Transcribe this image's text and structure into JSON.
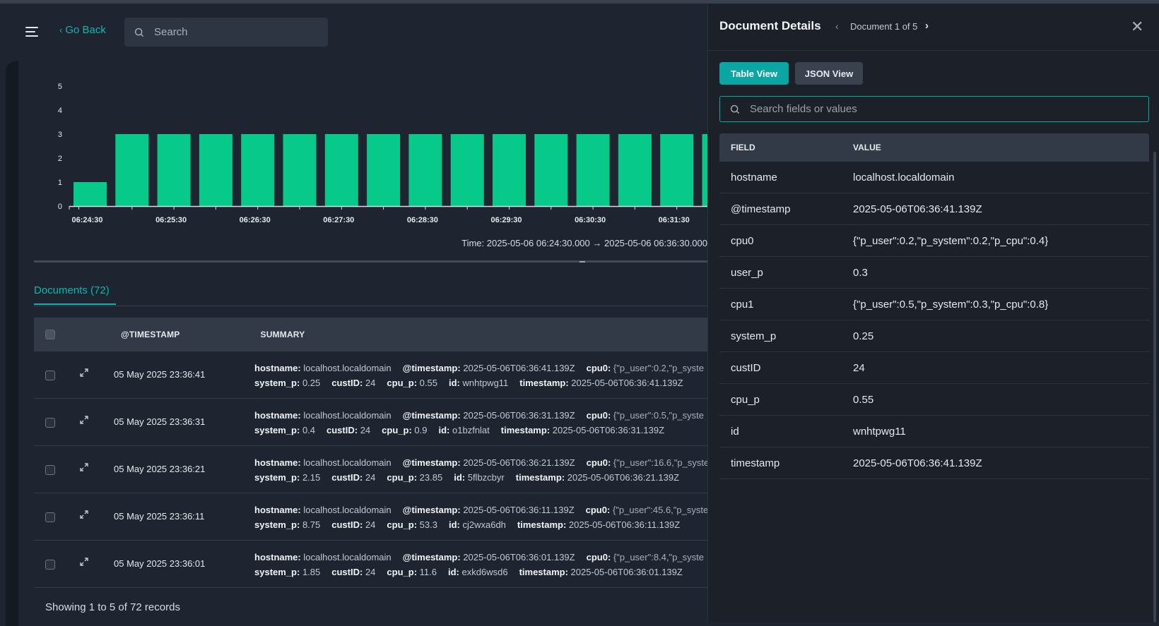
{
  "header": {
    "go_back": "Go Back",
    "search_placeholder": "Search"
  },
  "chart_data": {
    "type": "bar",
    "y_ticks": [
      "0",
      "1",
      "2",
      "3",
      "4",
      "5"
    ],
    "ylim": [
      0,
      5
    ],
    "x_tick_labels": [
      "06:24:30",
      "06:25:30",
      "06:26:30",
      "06:27:30",
      "06:28:30",
      "06:29:30",
      "06:30:30",
      "06:31:30"
    ],
    "values": [
      1,
      3,
      3,
      3,
      3,
      3,
      3,
      3,
      3,
      3,
      3,
      3,
      3,
      3,
      3,
      3
    ],
    "color": "#06c98a",
    "time_range": "Time: 2025-05-06 06:24:30.000 → 2025-05-06 06:36:30.000"
  },
  "documents": {
    "tab_label": "Documents (72)",
    "columns": {
      "timestamp": "@TIMESTAMP",
      "summary": "SUMMARY"
    },
    "rows": [
      {
        "ts": "05 May 2025 23:36:41",
        "line1": [
          [
            "hostname:",
            "localhost.localdomain"
          ],
          [
            "@timestamp:",
            "2025-05-06T06:36:41.139Z"
          ],
          [
            "cpu0:",
            "{\"p_user\":0.2,\"p_syste"
          ]
        ],
        "line2": [
          [
            "system_p:",
            "0.25"
          ],
          [
            "custID:",
            "24"
          ],
          [
            "cpu_p:",
            "0.55"
          ],
          [
            "id:",
            "wnhtpwg11"
          ],
          [
            "timestamp:",
            "2025-05-06T06:36:41.139Z"
          ]
        ]
      },
      {
        "ts": "05 May 2025 23:36:31",
        "line1": [
          [
            "hostname:",
            "localhost.localdomain"
          ],
          [
            "@timestamp:",
            "2025-05-06T06:36:31.139Z"
          ],
          [
            "cpu0:",
            "{\"p_user\":0.5,\"p_syste"
          ]
        ],
        "line2": [
          [
            "system_p:",
            "0.4"
          ],
          [
            "custID:",
            "24"
          ],
          [
            "cpu_p:",
            "0.9"
          ],
          [
            "id:",
            "o1bzfnlat"
          ],
          [
            "timestamp:",
            "2025-05-06T06:36:31.139Z"
          ]
        ]
      },
      {
        "ts": "05 May 2025 23:36:21",
        "line1": [
          [
            "hostname:",
            "localhost.localdomain"
          ],
          [
            "@timestamp:",
            "2025-05-06T06:36:21.139Z"
          ],
          [
            "cpu0:",
            "{\"p_user\":16.6,\"p_syste"
          ]
        ],
        "line2": [
          [
            "system_p:",
            "2.15"
          ],
          [
            "custID:",
            "24"
          ],
          [
            "cpu_p:",
            "23.85"
          ],
          [
            "id:",
            "5flbzcbyr"
          ],
          [
            "timestamp:",
            "2025-05-06T06:36:21.139Z"
          ]
        ]
      },
      {
        "ts": "05 May 2025 23:36:11",
        "line1": [
          [
            "hostname:",
            "localhost.localdomain"
          ],
          [
            "@timestamp:",
            "2025-05-06T06:36:11.139Z"
          ],
          [
            "cpu0:",
            "{\"p_user\":45.6,\"p_syste"
          ]
        ],
        "line2": [
          [
            "system_p:",
            "8.75"
          ],
          [
            "custID:",
            "24"
          ],
          [
            "cpu_p:",
            "53.3"
          ],
          [
            "id:",
            "cj2wxa6dh"
          ],
          [
            "timestamp:",
            "2025-05-06T06:36:11.139Z"
          ]
        ]
      },
      {
        "ts": "05 May 2025 23:36:01",
        "line1": [
          [
            "hostname:",
            "localhost.localdomain"
          ],
          [
            "@timestamp:",
            "2025-05-06T06:36:01.139Z"
          ],
          [
            "cpu0:",
            "{\"p_user\":8.4,\"p_syste"
          ]
        ],
        "line2": [
          [
            "system_p:",
            "1.85"
          ],
          [
            "custID:",
            "24"
          ],
          [
            "cpu_p:",
            "11.6"
          ],
          [
            "id:",
            "exkd6wsd6"
          ],
          [
            "timestamp:",
            "2025-05-06T06:36:01.139Z"
          ]
        ]
      }
    ],
    "footer": "Showing 1 to 5 of 72 records"
  },
  "panel": {
    "title": "Document Details",
    "counter": "Document 1 of 5",
    "table_view": "Table View",
    "json_view": "JSON View",
    "search_placeholder": "Search fields or values",
    "col_field": "FIELD",
    "col_value": "VALUE",
    "fields": [
      [
        "hostname",
        "localhost.localdomain"
      ],
      [
        "@timestamp",
        "2025-05-06T06:36:41.139Z"
      ],
      [
        "cpu0",
        "{\"p_user\":0.2,\"p_system\":0.2,\"p_cpu\":0.4}"
      ],
      [
        "user_p",
        "0.3"
      ],
      [
        "cpu1",
        "{\"p_user\":0.5,\"p_system\":0.3,\"p_cpu\":0.8}"
      ],
      [
        "system_p",
        "0.25"
      ],
      [
        "custID",
        "24"
      ],
      [
        "cpu_p",
        "0.55"
      ],
      [
        "id",
        "wnhtpwg11"
      ],
      [
        "timestamp",
        "2025-05-06T06:36:41.139Z"
      ]
    ]
  }
}
